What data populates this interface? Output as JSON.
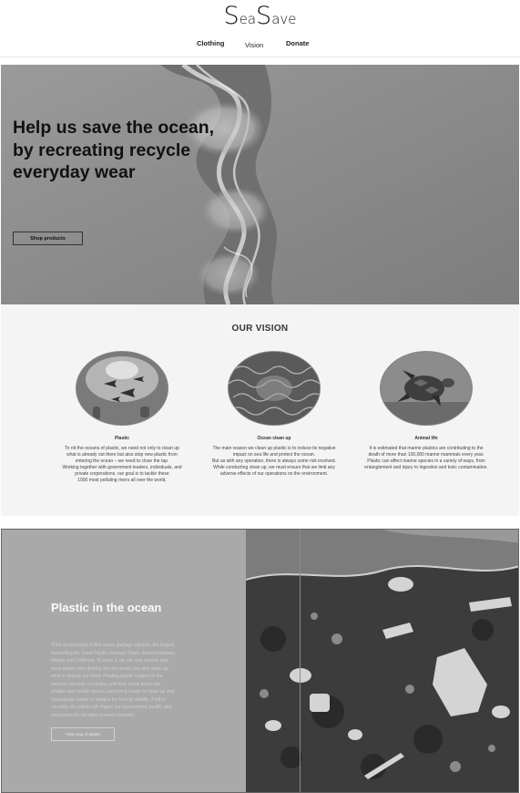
{
  "logo": {
    "s1": "S",
    "ea": "ea",
    "s2": "S",
    "ave": "ave"
  },
  "nav": {
    "items": [
      "Clothing",
      "Vision",
      "Donate"
    ]
  },
  "hero": {
    "title_lines": [
      "Help us save the ocean,",
      "by recreating recycle",
      "everyday wear"
    ],
    "button": "Shop products"
  },
  "vision": {
    "title": "OUR VISION",
    "columns": [
      {
        "title": "Plastic",
        "lines": [
          "To rid the oceans of plastic, we need not only to clean up",
          "what is already out there but also stop new plastic from",
          "entering the ocean – we need to close the tap.",
          "Working together with government leaders, individuals, and",
          "private corporations, our goal is to tackle these",
          "1000 most polluting rivers all over the world."
        ]
      },
      {
        "title": "Ocean clean up",
        "lines": [
          "The main reason we clean up plastic is to reduce its negative",
          "impact on sea life and protect the ocean.",
          "But as with any operation, there is always some risk involved.",
          "While conducting clean up, we must ensure that we limit any",
          "adverse effects of our operations on the environment."
        ]
      },
      {
        "title": "Animal life",
        "lines": [
          "It is estimated that marine plastics are contributing to the",
          "death of more than 100,000 marine mammals every year.",
          "Plastic can affect marine species in a variety of ways, from",
          "entanglement and injury to ingestion and toxic contamination."
        ]
      }
    ]
  },
  "plastic": {
    "title": "Plastic in the ocean",
    "lines": [
      "Their accumulates in five ocean garbage patches, the largest",
      "marauding the Great Pacific Garbage Patch, located between",
      "Hawaii and California. To solve it, we not only need to stop",
      "more plastic from flowing into the ocean, but also clean up",
      "what is already out there. Floating plastic trapped in the",
      "patches will keep circulating until they break down into",
      "smaller and smaller pieces, becoming harder to clean up and",
      "increasingly easier to mistake for food by wildlife. If left to",
      "circulate, the plastic will impact our ecosystems, health, and",
      "economies for decades or even centuries."
    ],
    "button": "View map of plastic"
  }
}
